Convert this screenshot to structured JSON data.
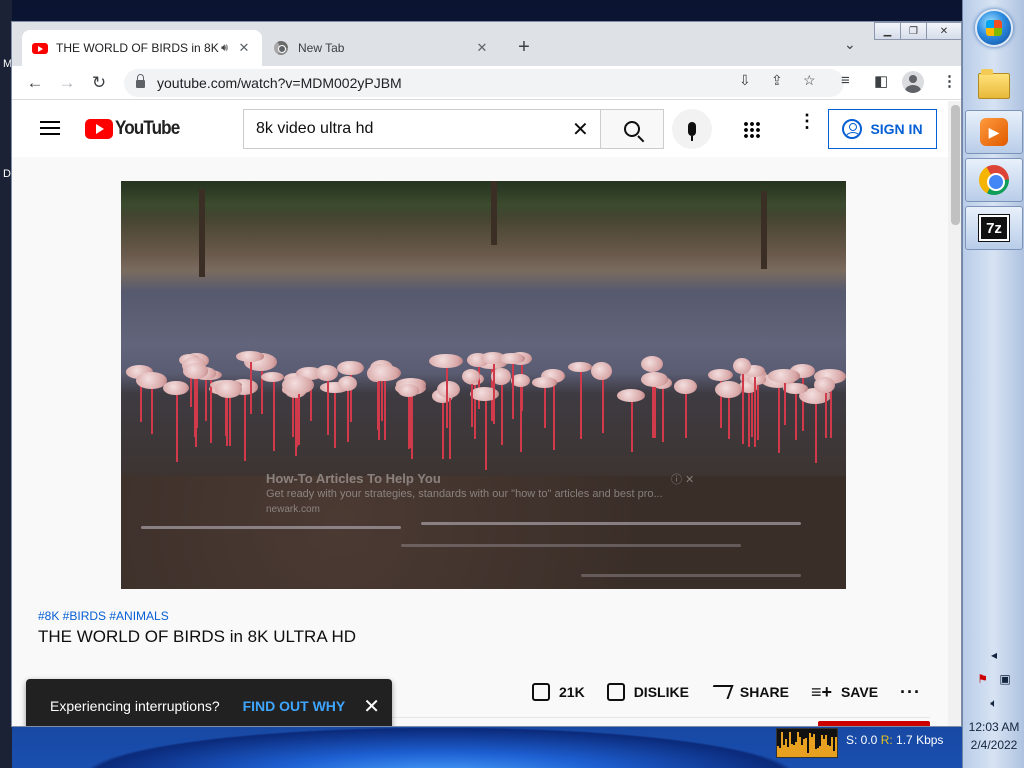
{
  "desktop": {
    "left_letters": [
      "M",
      "D"
    ]
  },
  "browser": {
    "tabs": [
      {
        "title": "THE WORLD OF BIRDS in 8K",
        "icon": "youtube-favicon-icon",
        "audio": true
      },
      {
        "title": "New Tab",
        "icon": "chrome-favicon-icon"
      }
    ],
    "url": "youtube.com/watch?v=MDM002yPJBM"
  },
  "youtube": {
    "logo_text": "YouTube",
    "search_value": "8k video ultra hd",
    "search_placeholder": "Search",
    "sign_in_label": "SIGN IN"
  },
  "video": {
    "ad_overlay": {
      "title": "How-To Articles To Help You",
      "body": "Get ready with your strategies, standards with our \"how to\" articles and best pro...",
      "url": "newark.com"
    },
    "hashtags": "#8K #BIRDS #ANIMALS",
    "title": "THE WORLD OF BIRDS in 8K ULTRA HD",
    "likes": "21K",
    "dislike_label": "DISLIKE",
    "share_label": "SHARE",
    "save_label": "SAVE"
  },
  "toast": {
    "message": "Experiencing interruptions?",
    "link": "FIND OUT WHY"
  },
  "taskbar": {
    "apps": [
      "start-orb-icon",
      "windows-explorer-icon",
      "media-player-icon",
      "chrome-icon",
      "7zip-icon"
    ],
    "time": "12:03 AM",
    "date": "2/4/2022"
  },
  "netmeter": {
    "sent": "S: 0.0",
    "received_label": "R:",
    "received_value": "1.7 Kbps"
  }
}
